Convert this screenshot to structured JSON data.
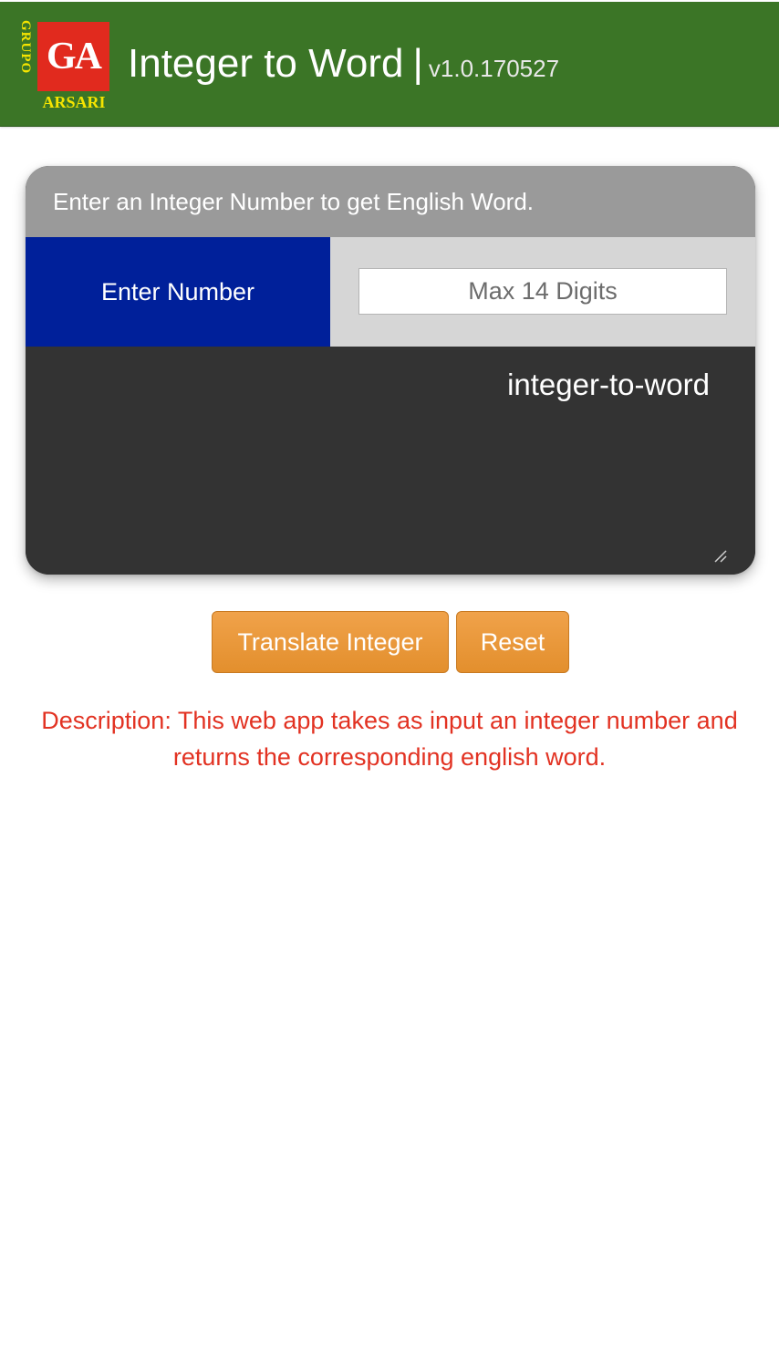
{
  "header": {
    "logo": {
      "vertical_text": "GRUPO",
      "mark": "GA",
      "bottom_text": "ARSARI",
      "colors": {
        "box": "#e12a1e",
        "text": "#f5e400"
      }
    },
    "title": "Integer to Word",
    "separator": "|",
    "version": "v1.0.170527",
    "background_color": "#3b7526"
  },
  "card": {
    "heading": "Enter an Integer Number to get English Word.",
    "input_label": "Enter Number",
    "input": {
      "value": "",
      "placeholder": "Max 14 Digits"
    },
    "output_text": "integer-to-word",
    "colors": {
      "label_bg": "#00209a",
      "header_bg": "#9a9a9a",
      "output_bg": "#333333"
    }
  },
  "buttons": {
    "translate_label": "Translate Integer",
    "reset_label": "Reset",
    "color": "#e8952f"
  },
  "description": {
    "text": "Description: This web app takes as input an integer number and returns the corresponding english word.",
    "color": "#e23222"
  }
}
